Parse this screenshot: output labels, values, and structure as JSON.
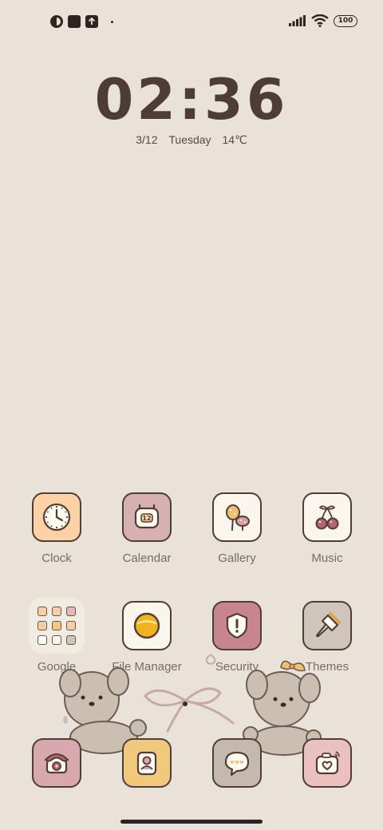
{
  "status_bar": {
    "left_icons": [
      "data-saver-icon",
      "notification-square-icon",
      "upload-icon",
      "more-dot-icon"
    ],
    "right_icons": [
      "signal-icon",
      "wifi-icon",
      "battery-icon"
    ],
    "battery": "100"
  },
  "clock": {
    "time": "02:36",
    "date": "3/12",
    "weekday": "Tuesday",
    "temperature": "14℃"
  },
  "apps": [
    {
      "label": "Clock",
      "icon": "clock-icon",
      "bg": "#fcd1a5"
    },
    {
      "label": "Calendar",
      "icon": "calendar-icon",
      "bg": "#d7b0b4"
    },
    {
      "label": "Gallery",
      "icon": "gallery-icon",
      "bg": "#faf6ee"
    },
    {
      "label": "Music",
      "icon": "cherry-icon",
      "bg": "#faf6ee"
    },
    {
      "label": "Google",
      "icon": "folder-icon",
      "bg": "#f1ece2"
    },
    {
      "label": "File Manager",
      "icon": "file-manager-icon",
      "bg": "#faf6ee"
    },
    {
      "label": "Security",
      "icon": "security-icon",
      "bg": "#c7868f"
    },
    {
      "label": "Themes",
      "icon": "brush-icon",
      "bg": "#cfc5bb"
    }
  ],
  "dock": [
    {
      "icon": "phone-icon",
      "bg": "#d7a8ae"
    },
    {
      "icon": "contacts-icon",
      "bg": "#f1c97d"
    },
    {
      "icon": "messages-icon",
      "bg": "#c5b8ac"
    },
    {
      "icon": "camera-icon",
      "bg": "#ebc1c0"
    }
  ],
  "colors": {
    "background": "#e9e2d9",
    "text_dark": "#4e3c37",
    "label": "#7a6b65"
  }
}
